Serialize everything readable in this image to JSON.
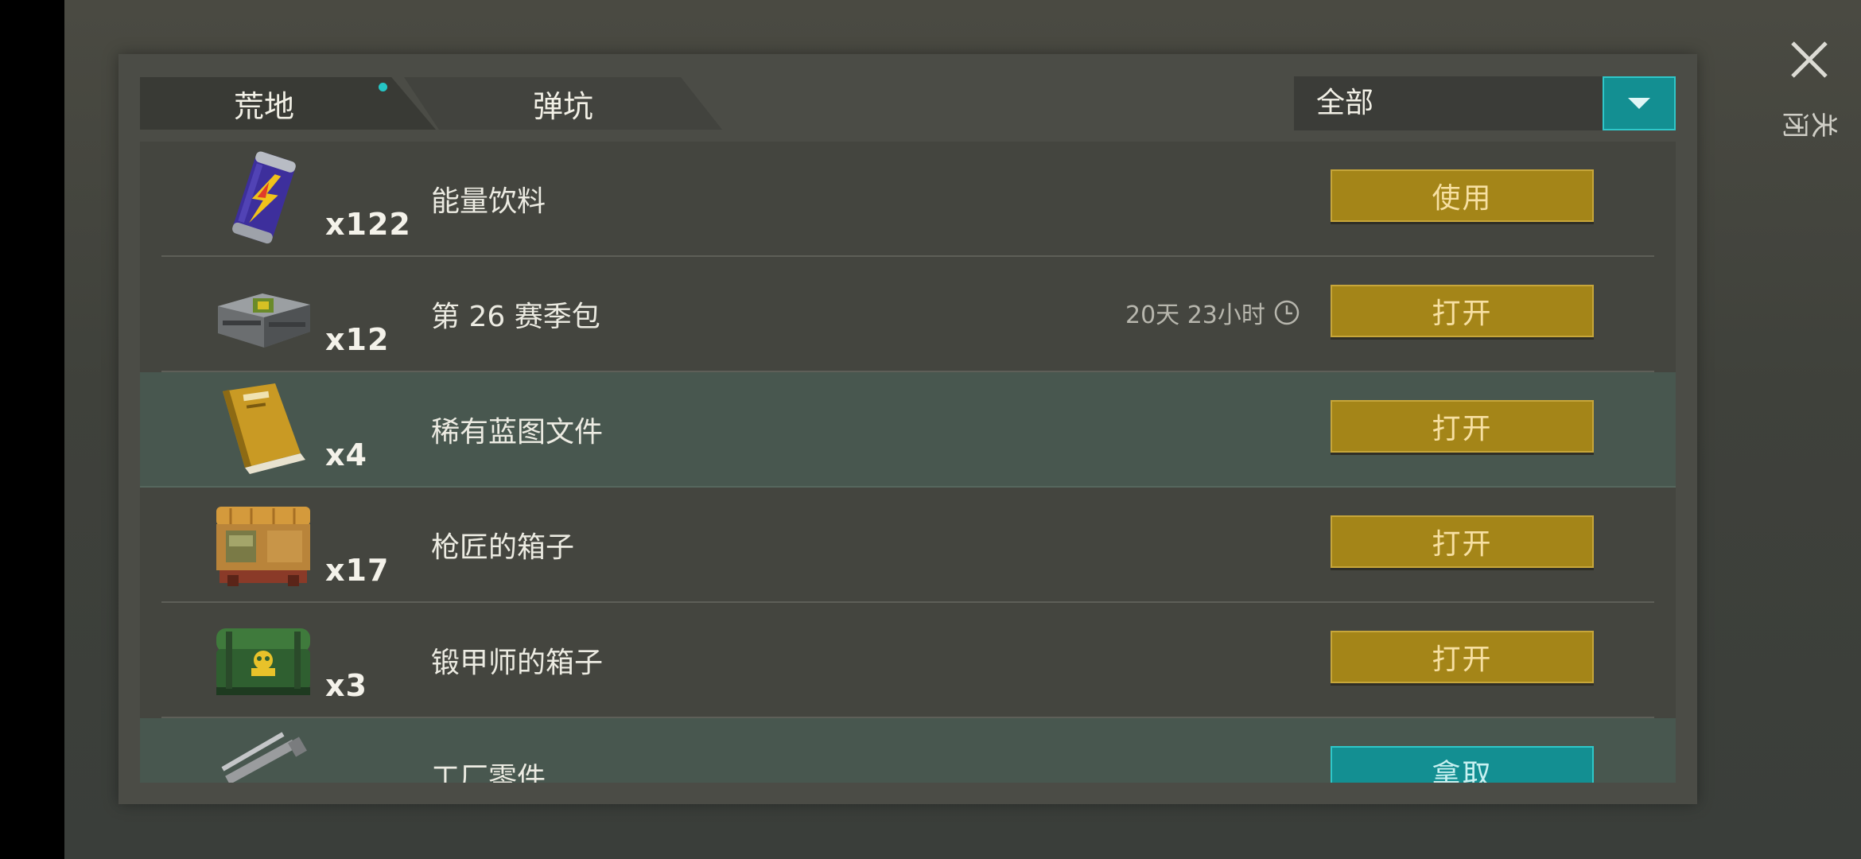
{
  "tabs": [
    {
      "label": "荒地",
      "active": true,
      "has_dot": true
    },
    {
      "label": "弹坑",
      "active": false
    }
  ],
  "filter": {
    "selected": "全部",
    "icon": "chevron-down-icon"
  },
  "close": {
    "label": "关闭",
    "icon": "close-icon"
  },
  "colors": {
    "accent_teal": "#138f92",
    "action_gold": "#a48518",
    "highlight_row": "#48574f"
  },
  "items": [
    {
      "name": "能量饮料",
      "quantity": "x122",
      "action": "使用",
      "icon": "energy-drink-can-icon",
      "timer": "",
      "highlight": false
    },
    {
      "name": "第 26 赛季包",
      "quantity": "x12",
      "action": "打开",
      "icon": "season-pack-crate-icon",
      "timer": "20天 23小时",
      "highlight": false
    },
    {
      "name": "稀有蓝图文件",
      "quantity": "x4",
      "action": "打开",
      "icon": "blueprint-folder-icon",
      "timer": "",
      "highlight": true
    },
    {
      "name": "枪匠的箱子",
      "quantity": "x17",
      "action": "打开",
      "icon": "wooden-crate-icon",
      "timer": "",
      "highlight": false
    },
    {
      "name": "锻甲师的箱子",
      "quantity": "x3",
      "action": "打开",
      "icon": "green-armor-box-icon",
      "timer": "",
      "highlight": false
    },
    {
      "name": "工厂零件",
      "quantity": "",
      "action": "拿取",
      "icon": "factory-parts-icon",
      "timer": "",
      "highlight": true
    }
  ]
}
